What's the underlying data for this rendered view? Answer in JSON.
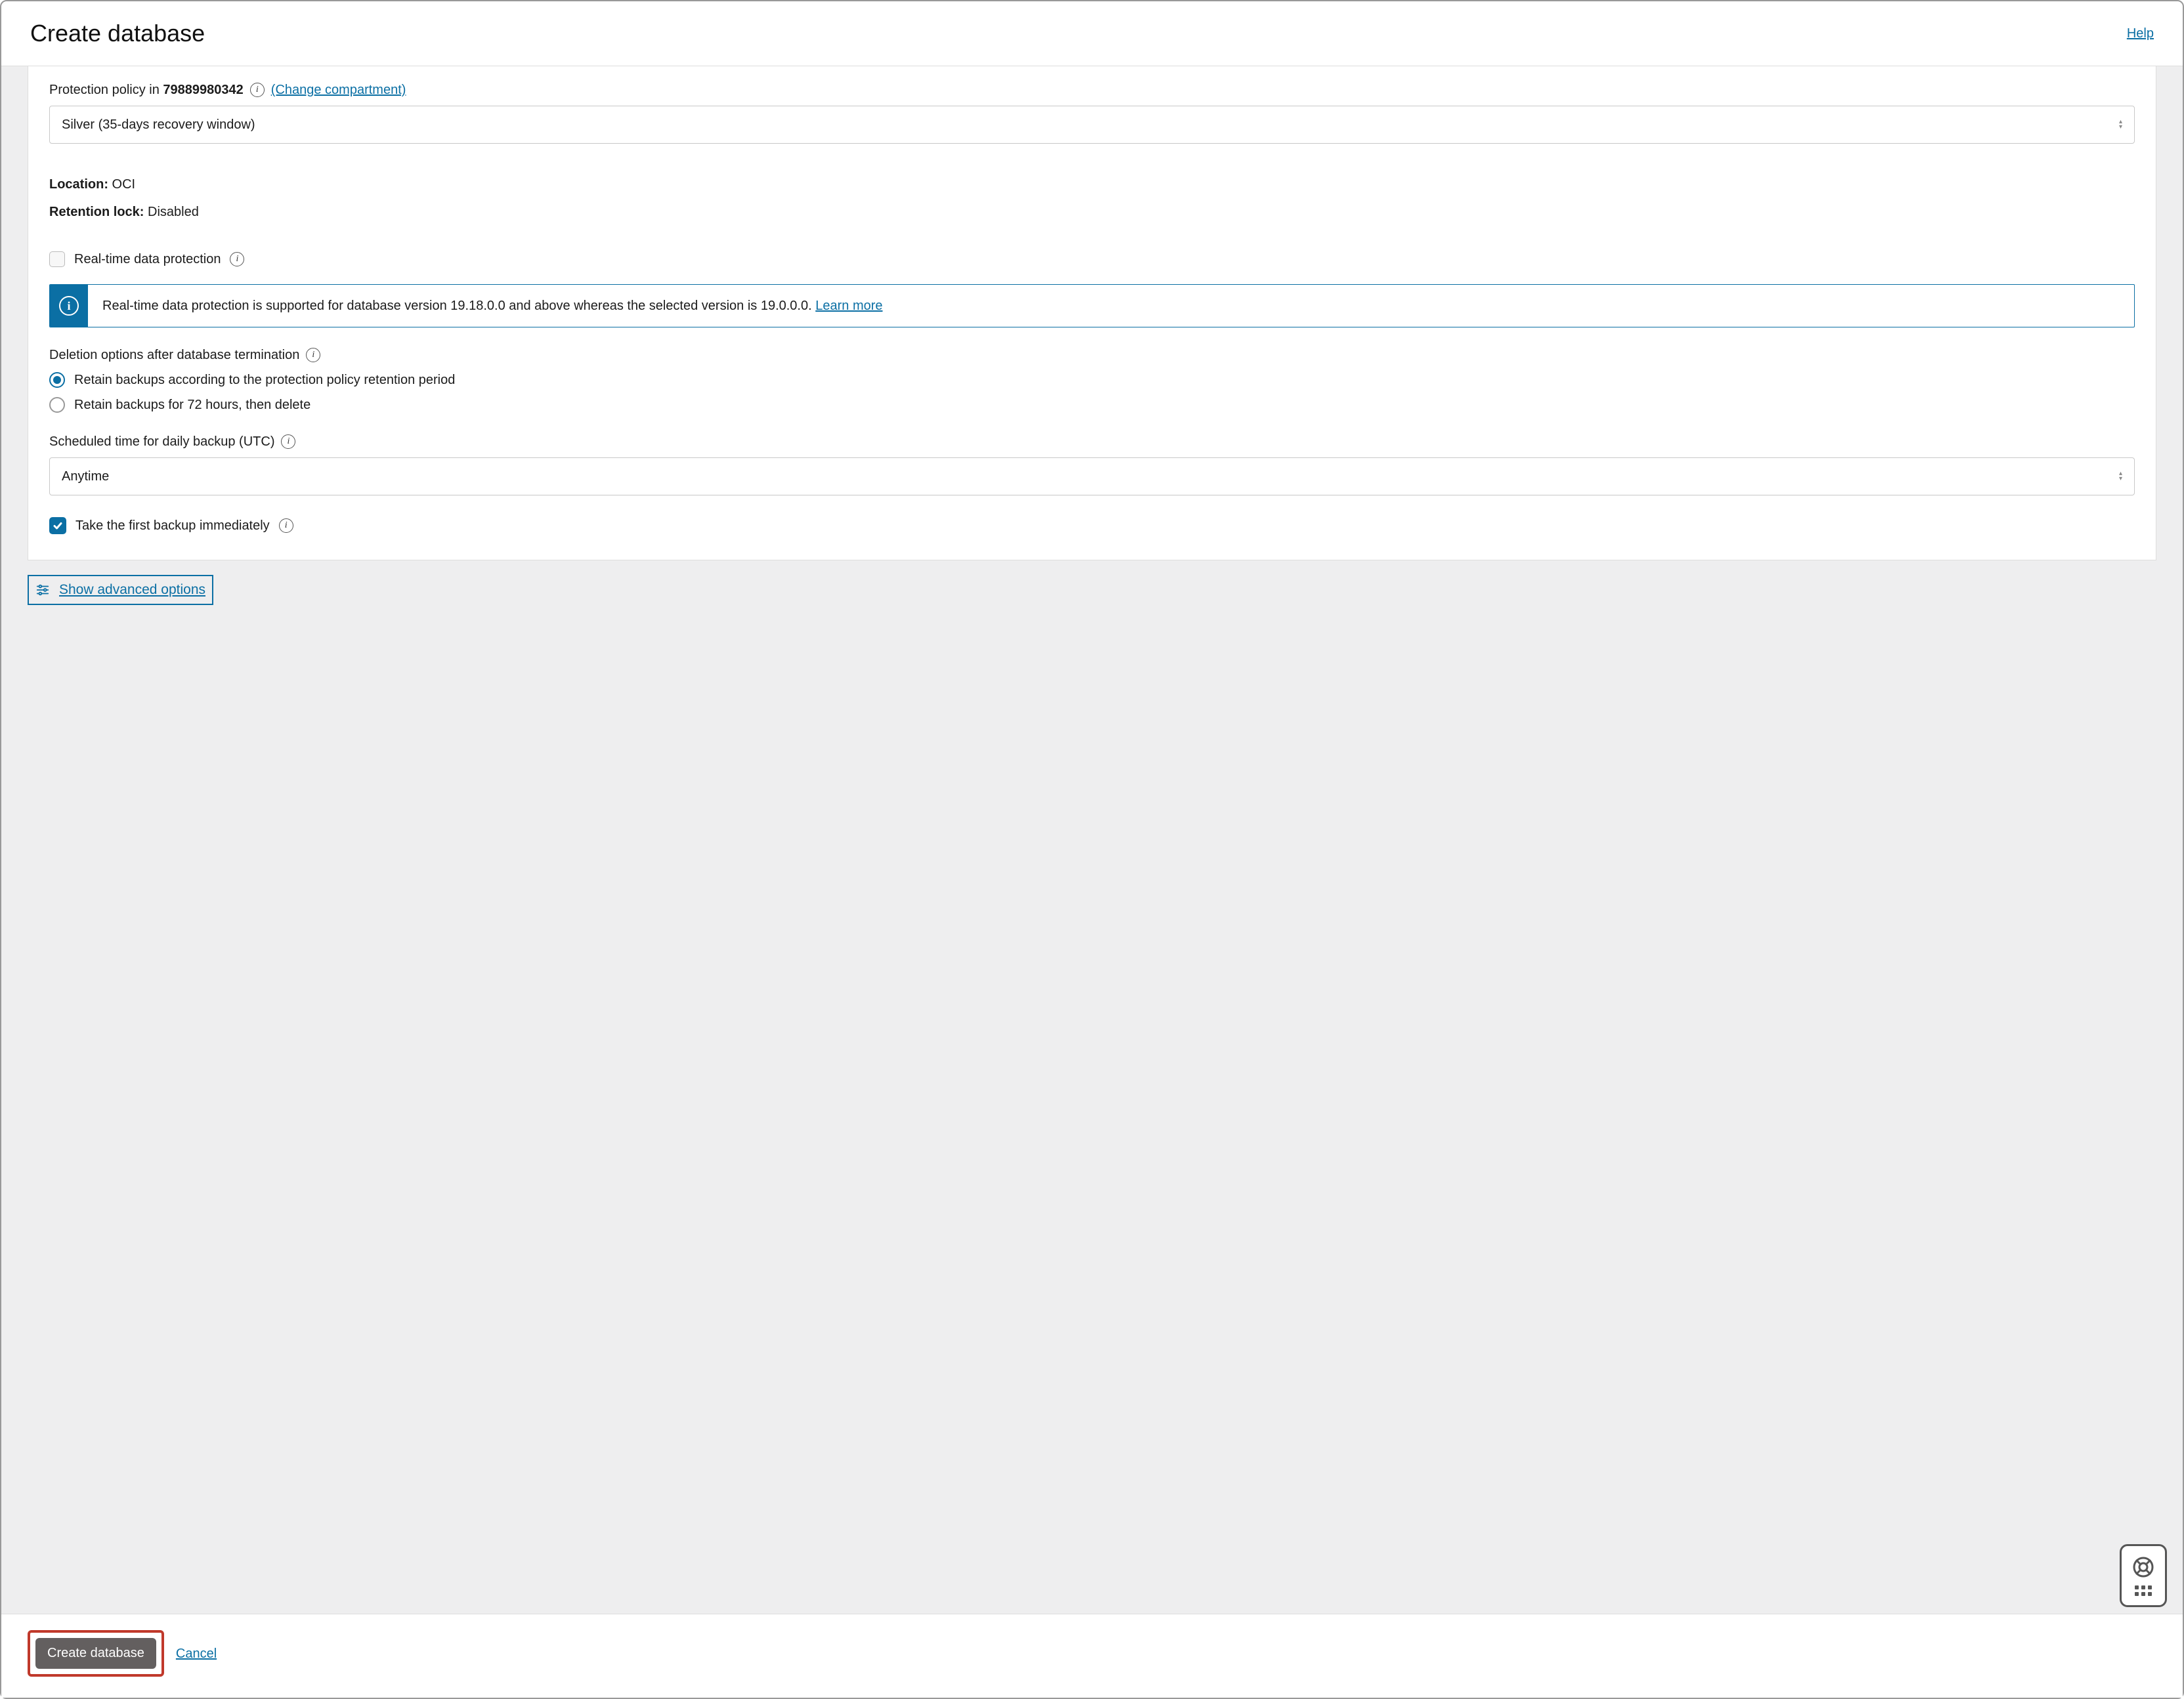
{
  "header": {
    "title": "Create database",
    "help": "Help"
  },
  "protection_policy": {
    "label_prefix": "Protection policy in ",
    "compartment": "79889980342",
    "change_link": "(Change compartment)",
    "selected": "Silver (35-days recovery window)"
  },
  "kv": {
    "location_key": "Location:",
    "location_val": " OCI",
    "retention_key": "Retention lock:",
    "retention_val": " Disabled"
  },
  "realtime": {
    "label": "Real-time data protection",
    "banner": "Real-time data protection is supported for database version 19.18.0.0 and above whereas the selected version is 19.0.0.0. ",
    "learn_more": "Learn more"
  },
  "deletion": {
    "label": "Deletion options after database termination",
    "opt1": "Retain backups according to the protection policy retention period",
    "opt2": "Retain backups for 72 hours, then delete"
  },
  "schedule": {
    "label": "Scheduled time for daily backup (UTC)",
    "selected": "Anytime"
  },
  "first_backup": {
    "label": "Take the first backup immediately"
  },
  "advanced": {
    "label": "Show advanced options"
  },
  "footer": {
    "create": "Create database",
    "cancel": "Cancel"
  }
}
